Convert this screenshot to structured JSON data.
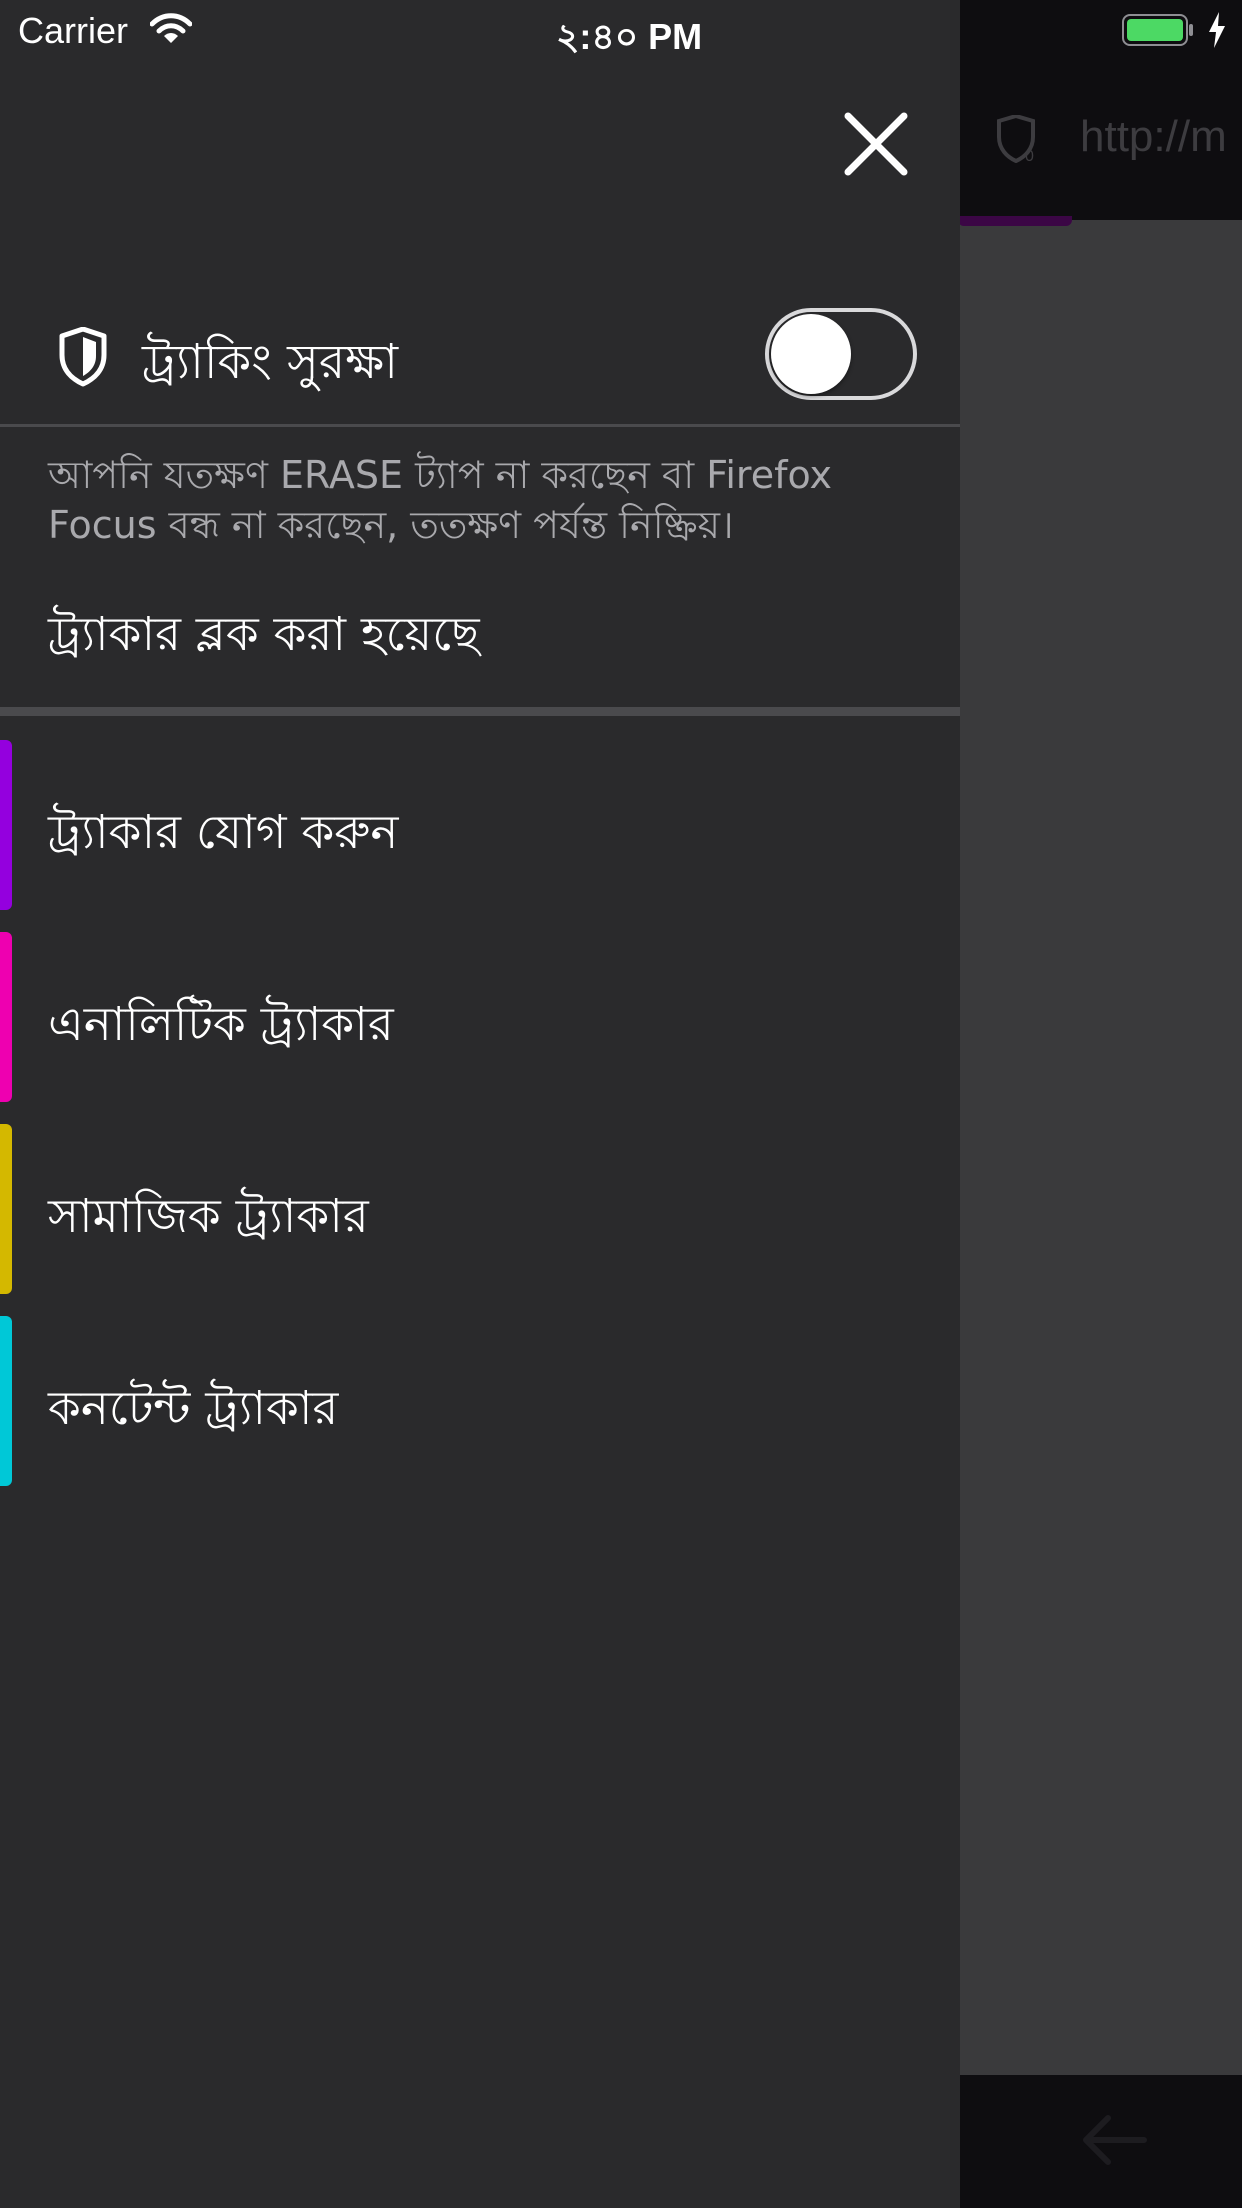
{
  "status_bar": {
    "carrier": "Carrier",
    "time": "২:৪০ PM",
    "battery_color": "#4cd964"
  },
  "background_browser": {
    "url_text": "http://m"
  },
  "drawer": {
    "close_icon": "close-icon",
    "tracking_protection": {
      "label": "ট্র্যাকিং সুরক্ষা",
      "icon": "shield-icon",
      "toggle_on": false
    },
    "description": "আপনি যতক্ষণ ERASE ট্যাপ না করছেন বা Firefox Focus বন্ধ না করছেন, ততক্ষণ পর্যন্ত নিষ্ক্রিয়।",
    "trackers_blocked_label": "ট্র্যাকার ব্লক করা হয়েছে",
    "tracker_categories": [
      {
        "label": "ট্র্যাকার যোগ করুন",
        "color": "#9400de"
      },
      {
        "label": "এনালিটিক ট্র্যাকার",
        "color": "#ee00b0"
      },
      {
        "label": "সামাজিক ট্র্যাকার",
        "color": "#d4b800"
      },
      {
        "label": "কনটেন্ট ট্র্যাকার",
        "color": "#00c8d7"
      }
    ]
  }
}
